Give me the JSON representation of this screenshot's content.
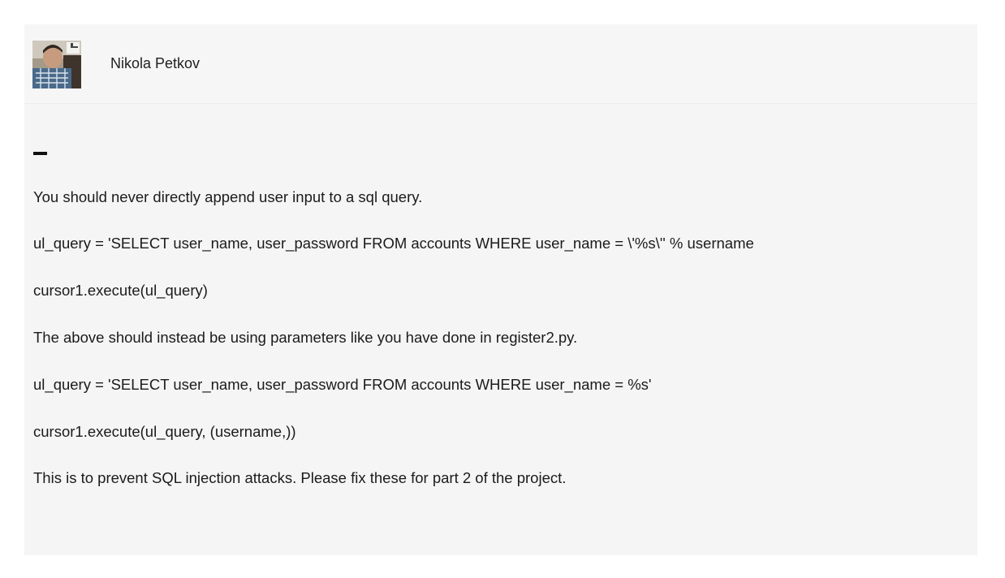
{
  "comment": {
    "author": "Nikola Petkov",
    "avatar_icon": "user-photo-icon",
    "paragraphs": [
      "You should never directly append user input to a sql query.",
      "ul_query = 'SELECT user_name, user_password FROM accounts WHERE user_name = \\'%s\\'' % username",
      "cursor1.execute(ul_query)",
      "The above should instead be using parameters like you have done in register2.py.",
      "ul_query = 'SELECT user_name, user_password FROM accounts WHERE user_name = %s'",
      "cursor1.execute(ul_query, (username,))",
      "This is to prevent SQL injection attacks. Please fix these for part 2 of the project."
    ]
  }
}
